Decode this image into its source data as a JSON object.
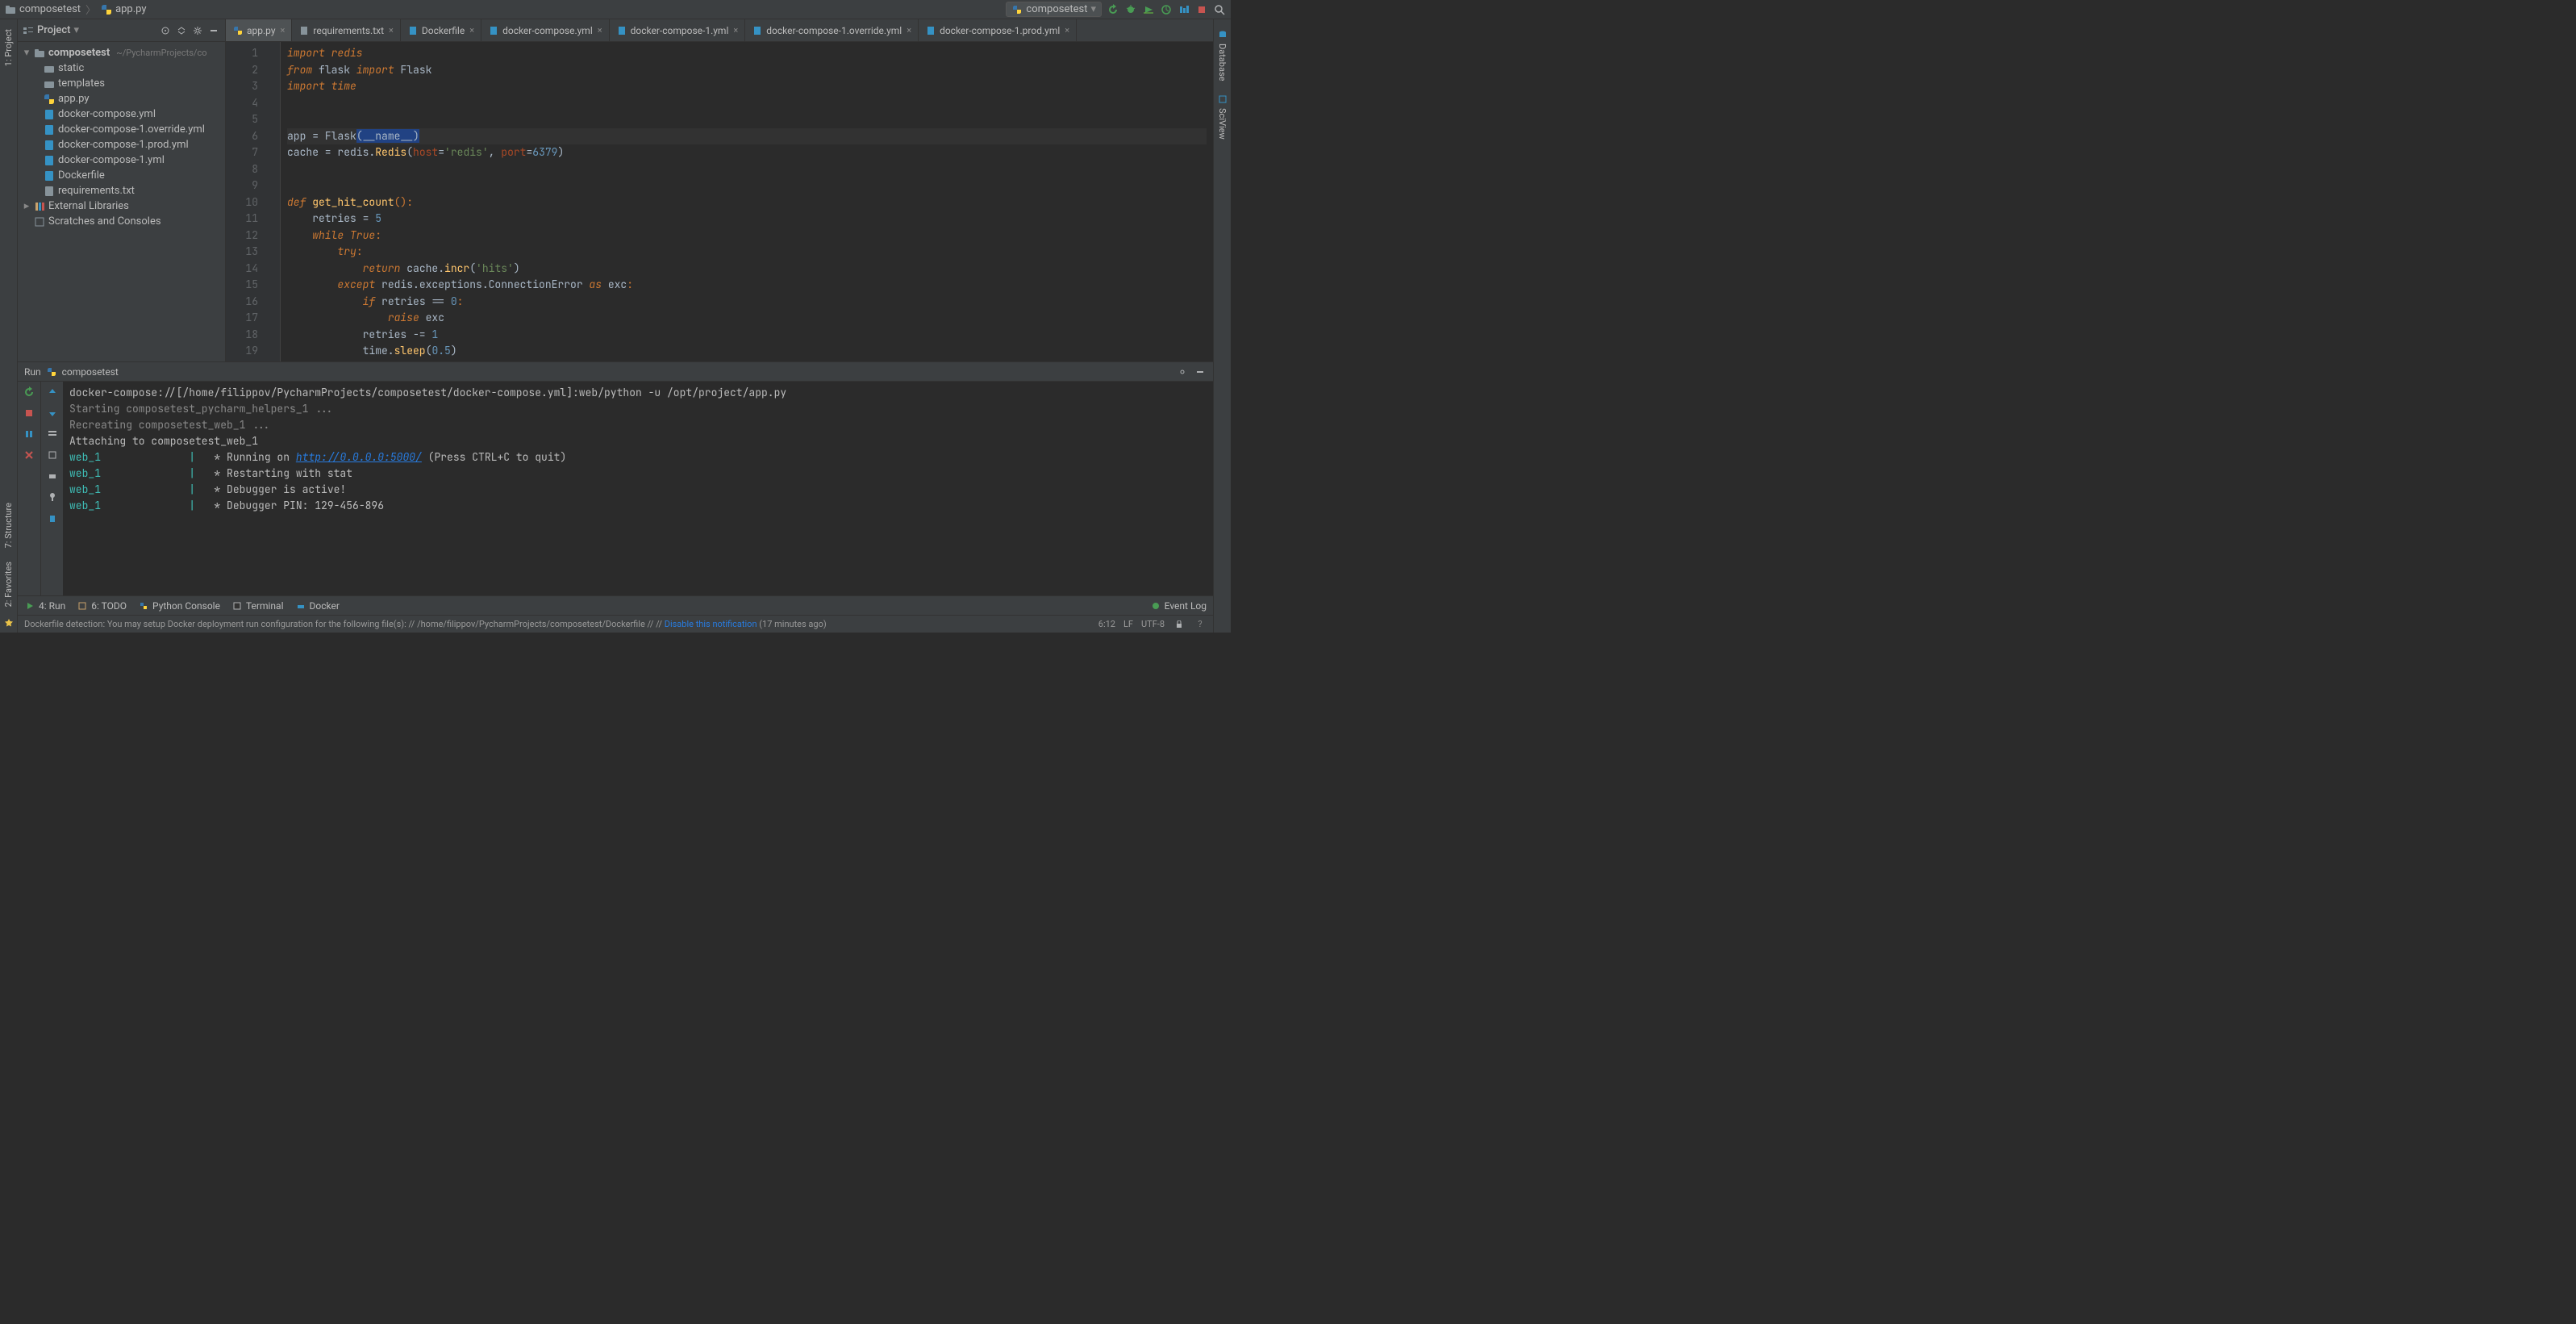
{
  "breadcrumb": {
    "project": "composetest",
    "file": "app.py"
  },
  "run_config": {
    "name": "composetest"
  },
  "left_rail": {
    "project": "1: Project",
    "structure": "7: Structure",
    "favorites": "2: Favorites"
  },
  "right_rail": {
    "database": "Database",
    "sciview": "SciView"
  },
  "project_pane": {
    "title": "Project",
    "root": "composetest",
    "root_path": "~/PycharmProjects/co",
    "items": [
      {
        "name": "static",
        "type": "dir"
      },
      {
        "name": "templates",
        "type": "dir"
      },
      {
        "name": "app.py",
        "type": "py"
      },
      {
        "name": "docker-compose.yml",
        "type": "yml"
      },
      {
        "name": "docker-compose-1.override.yml",
        "type": "yml"
      },
      {
        "name": "docker-compose-1.prod.yml",
        "type": "yml"
      },
      {
        "name": "docker-compose-1.yml",
        "type": "yml"
      },
      {
        "name": "Dockerfile",
        "type": "docker"
      },
      {
        "name": "requirements.txt",
        "type": "txt"
      }
    ],
    "ext_lib": "External Libraries",
    "scratches": "Scratches and Consoles"
  },
  "tabs": [
    {
      "name": "app.py",
      "type": "py",
      "active": true
    },
    {
      "name": "requirements.txt",
      "type": "txt"
    },
    {
      "name": "Dockerfile",
      "type": "docker"
    },
    {
      "name": "docker-compose.yml",
      "type": "yml"
    },
    {
      "name": "docker-compose-1.yml",
      "type": "yml"
    },
    {
      "name": "docker-compose-1.override.yml",
      "type": "yml"
    },
    {
      "name": "docker-compose-1.prod.yml",
      "type": "yml"
    }
  ],
  "editor": {
    "line_count": 20,
    "l1": "import redis",
    "l2a": "from ",
    "l2b": "flask ",
    "l2c": "import ",
    "l2d": "Flask",
    "l3": "import time",
    "l6a": "app = ",
    "l6b": "Flask",
    "l6c": "(",
    "l6d": "__name__",
    "l6e": ")",
    "l7a": "cache = redis.",
    "l7b": "Redis",
    "l7c": "(",
    "l7d": "host",
    "l7e": "=",
    "l7f": "'redis'",
    "l7g": ", ",
    "l7h": "port",
    "l7i": "=",
    "l7j": "6379",
    "l7k": ")",
    "l10a": "def ",
    "l10b": "get_hit_count",
    "l10c": "():",
    "l11a": "    retries = ",
    "l11b": "5",
    "l12a": "    ",
    "l12b": "while True",
    "l12c": ":",
    "l13a": "        ",
    "l13b": "try",
    "l13c": ":",
    "l14a": "            ",
    "l14b": "return ",
    "l14c": "cache.",
    "l14d": "incr",
    "l14e": "(",
    "l14f": "'hits'",
    "l14g": ")",
    "l15a": "        ",
    "l15b": "except ",
    "l15c": "redis.exceptions.ConnectionError ",
    "l15d": "as ",
    "l15e": "exc",
    "l15f": ":",
    "l16a": "            ",
    "l16b": "if ",
    "l16c": "retries == ",
    "l16d": "0",
    "l16e": ":",
    "l17a": "                ",
    "l17b": "raise ",
    "l17c": "exc",
    "l18a": "            retries -= ",
    "l18b": "1",
    "l19a": "            time.",
    "l19b": "sleep",
    "l19c": "(",
    "l19d": "0.5",
    "l19e": ")"
  },
  "run": {
    "title_prefix": "Run",
    "title_name": "composetest",
    "cmd": "docker-compose://[/home/filippov/PycharmProjects/composetest/docker-compose.yml]:web/python -u /opt/project/app.py",
    "starting": "Starting composetest_pycharm_helpers_1 ...",
    "recreating": "Recreating composetest_web_1 ...",
    "attaching": "Attaching to composetest_web_1",
    "web": "web_1",
    "pipe": "|",
    "r1a": "   * Running on ",
    "r1b": "http://0.0.0.0:5000/",
    "r1c": " (Press CTRL+C to quit)",
    "r2": "   * Restarting with stat",
    "r3": "   * Debugger is active!",
    "r4": "   * Debugger PIN: 129-456-896",
    "web_pad": "              "
  },
  "bottom_tabs": {
    "run": "4: Run",
    "todo": "6: TODO",
    "python_console": "Python Console",
    "terminal": "Terminal",
    "docker": "Docker",
    "event_log": "Event Log"
  },
  "status": {
    "msg_a": "Dockerfile detection: You may setup Docker deployment run configuration for the following file(s): // /home/filippov/PycharmProjects/composetest/Dockerfile // // ",
    "msg_b": "Disable this notification",
    "msg_c": " (17 minutes ago)",
    "pos": "6:12",
    "sep": "LF",
    "enc": "UTF-8"
  }
}
